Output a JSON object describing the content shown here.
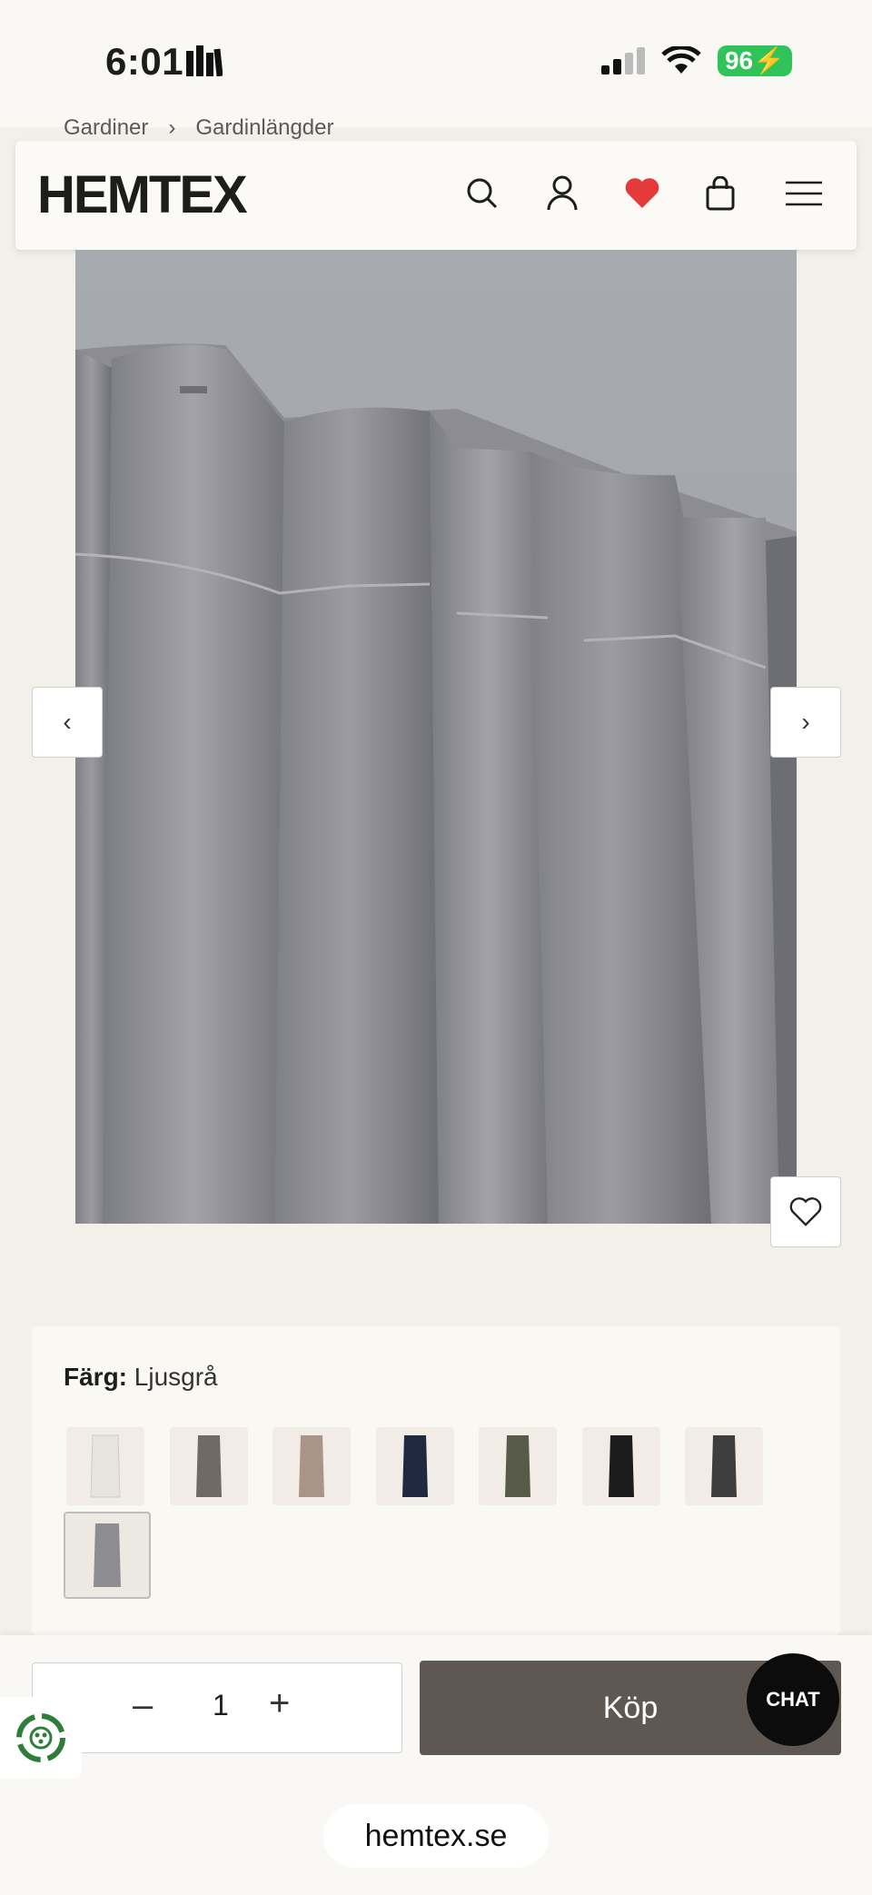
{
  "status_bar": {
    "time": "6:01",
    "battery": "96"
  },
  "breadcrumb": {
    "items": [
      "Gardiner",
      "Gardinlängder"
    ],
    "separator": "›"
  },
  "header": {
    "logo": "HEMTEX",
    "icons": [
      "search-icon",
      "user-icon",
      "heart-icon",
      "bag-icon",
      "menu-icon"
    ],
    "heart_color": "#e5393a"
  },
  "gallery": {
    "prev": "‹",
    "next": "›",
    "subject": "grey velvet curtain"
  },
  "variant": {
    "label": "Färg:",
    "value": "Ljusgrå",
    "swatches": [
      {
        "name": "white",
        "color": "#e6e4df"
      },
      {
        "name": "grey-brown",
        "color": "#6f6a64"
      },
      {
        "name": "beige",
        "color": "#a89488"
      },
      {
        "name": "navy",
        "color": "#1f2a40"
      },
      {
        "name": "olive",
        "color": "#575a48"
      },
      {
        "name": "black",
        "color": "#1c1c1c"
      },
      {
        "name": "charcoal",
        "color": "#3e3e3e"
      },
      {
        "name": "light-grey",
        "color": "#8d8c90",
        "selected": true
      }
    ]
  },
  "purchase": {
    "quantity": "1",
    "minus": "–",
    "plus": "+",
    "buy_label": "Köp",
    "chat_label": "CHAT"
  },
  "browser": {
    "url": "hemtex.se"
  },
  "colors": {
    "buy_button": "#5f5852",
    "background": "#f3f0ea"
  }
}
